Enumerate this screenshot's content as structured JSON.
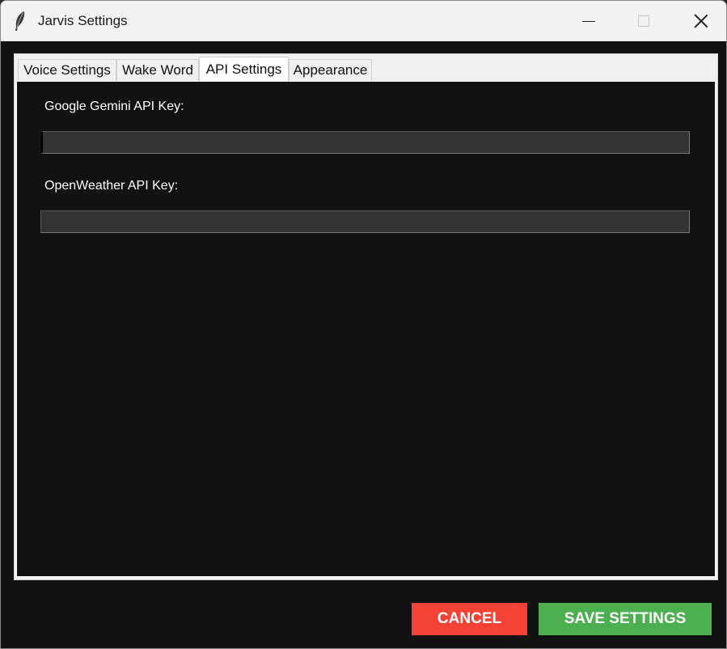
{
  "window": {
    "title": "Jarvis Settings",
    "icon": "feather-icon"
  },
  "tabs": [
    {
      "label": "Voice Settings",
      "active": false
    },
    {
      "label": "Wake Word",
      "active": false
    },
    {
      "label": "API Settings",
      "active": true
    },
    {
      "label": "Appearance",
      "active": false
    }
  ],
  "api_settings": {
    "gemini_label": "Google Gemini API Key:",
    "gemini_value": "",
    "weather_label": "OpenWeather API Key:",
    "weather_value": ""
  },
  "buttons": {
    "cancel_label": "CANCEL",
    "save_label": "SAVE SETTINGS"
  },
  "colors": {
    "background": "#121212",
    "entry_bg": "#333333",
    "cancel": "#f44336",
    "save": "#4caf50"
  }
}
